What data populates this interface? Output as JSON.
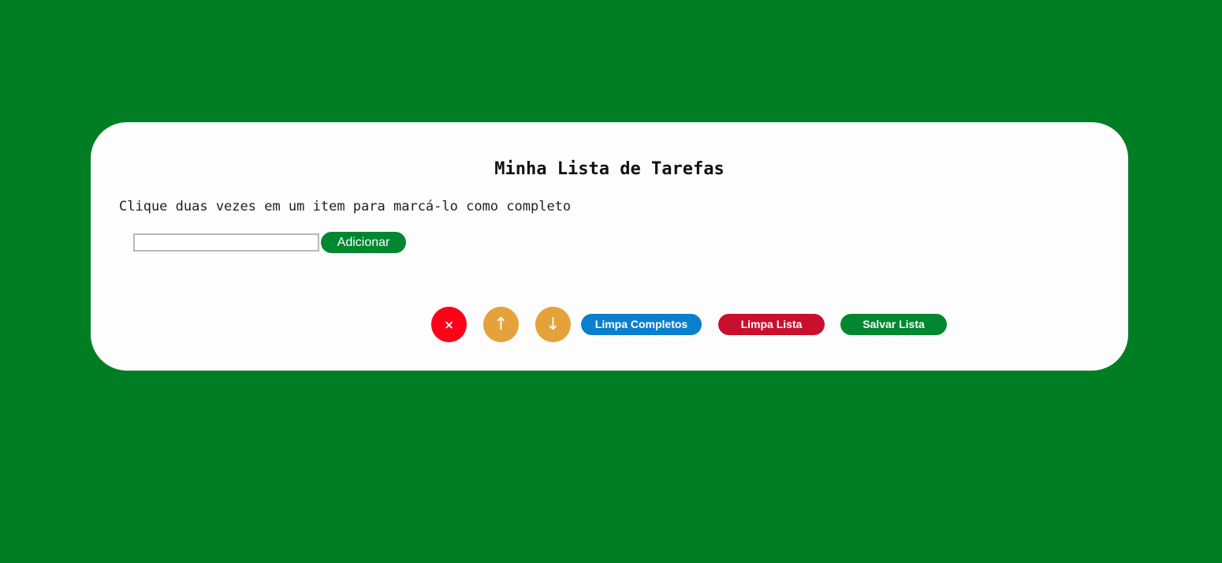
{
  "card": {
    "title": "Minha Lista de Tarefas",
    "instruction": "Clique duas vezes em um item para marcá-lo como completo"
  },
  "input": {
    "value": "",
    "add_label": "Adicionar"
  },
  "controls": {
    "delete_glyph": "×",
    "up_glyph": "↑",
    "down_glyph": "↓",
    "clear_completed_label": "Limpa Completos",
    "clear_list_label": "Limpa Lista",
    "save_list_label": "Salvar Lista"
  },
  "colors": {
    "background": "#017d24",
    "card": "#fdfdfd",
    "add_button": "#00872f",
    "delete_button": "#ff0019",
    "move_buttons": "#e6a23a",
    "clear_completed_button": "#0a7fce",
    "clear_list_button": "#c8102e",
    "save_list_button": "#00872f"
  },
  "icons": {
    "delete": "close-icon",
    "up": "arrow-up-icon",
    "down": "arrow-down-icon"
  }
}
